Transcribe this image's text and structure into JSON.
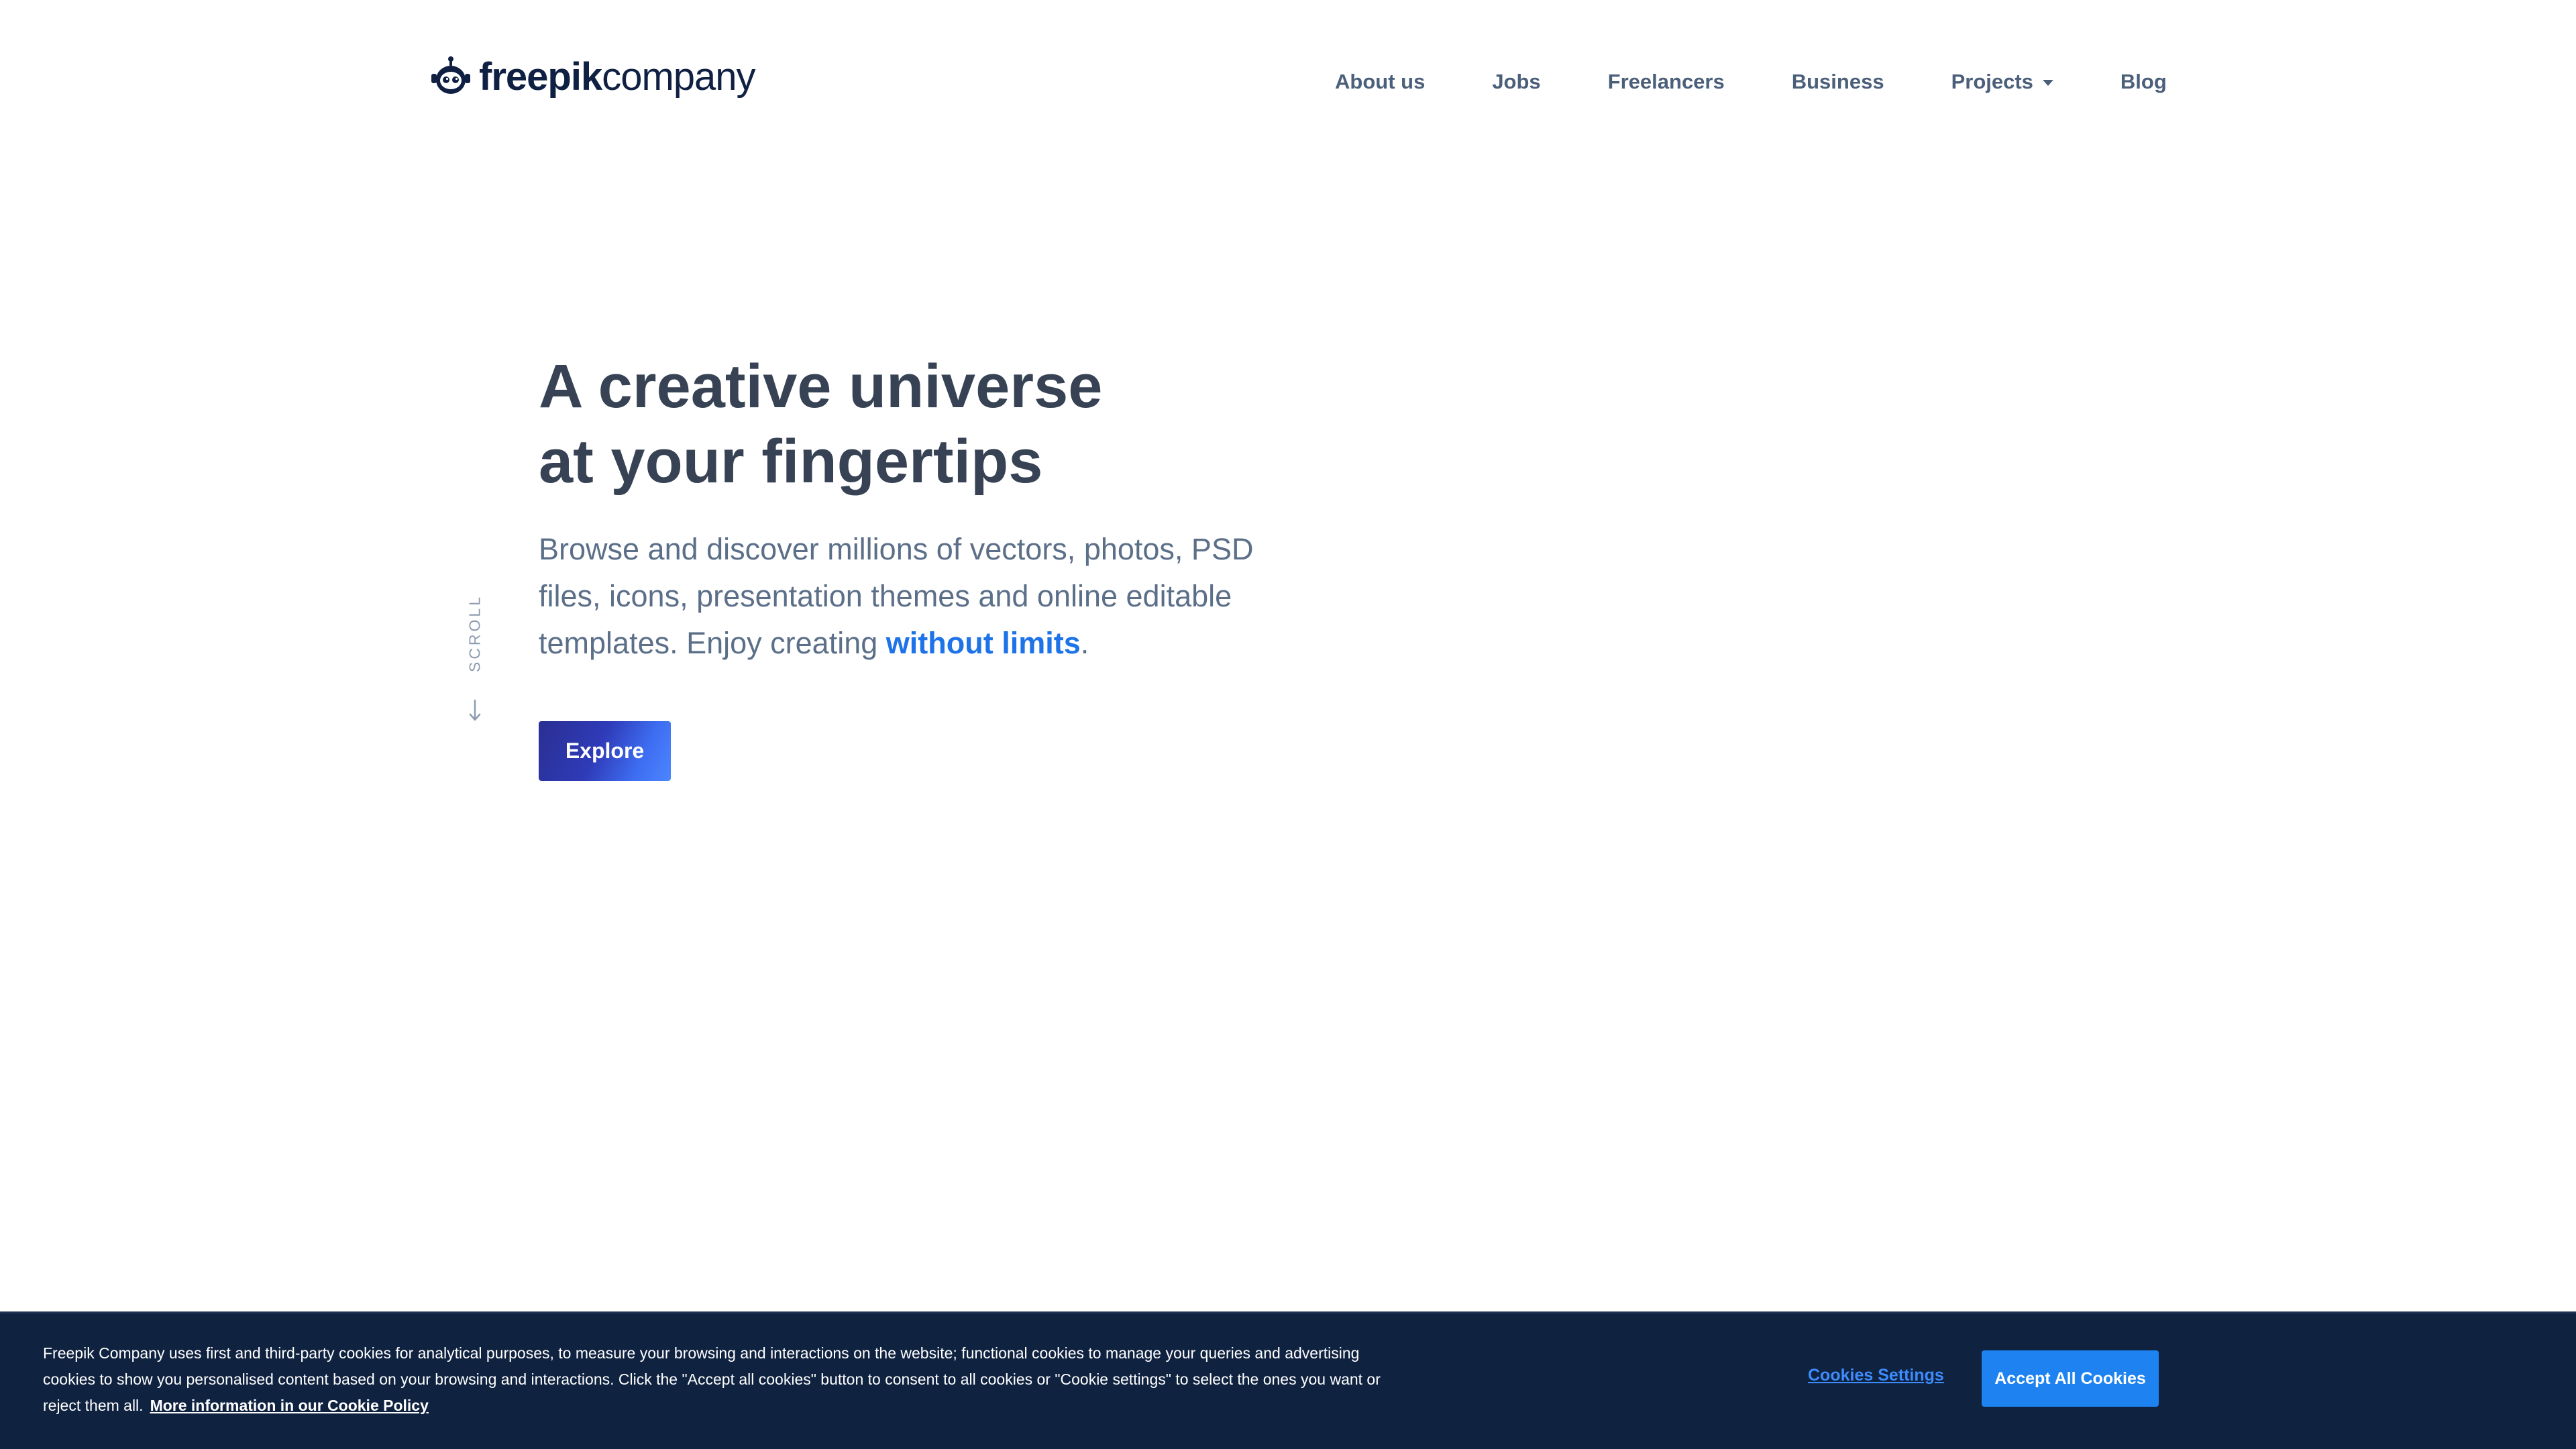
{
  "header": {
    "logo": {
      "icon": "freepik-mascot-icon",
      "text_bold": "freepik",
      "text_regular": "company"
    },
    "nav": [
      {
        "label": "About us"
      },
      {
        "label": "Jobs"
      },
      {
        "label": "Freelancers"
      },
      {
        "label": "Business"
      },
      {
        "label": "Projects",
        "has_dropdown": true
      },
      {
        "label": "Blog"
      }
    ]
  },
  "hero": {
    "title_line1": "A creative universe",
    "title_line2": "at your fingertips",
    "description_before": "Browse and discover millions of vectors, photos, PSD files, icons, presentation themes and online editable templates. Enjoy creating ",
    "description_highlight": "without limits",
    "description_after": ".",
    "cta_label": "Explore",
    "scroll_label": "SCROLL",
    "scroll_icon": "arrow-down-icon"
  },
  "cookie_banner": {
    "text": "Freepik Company uses first and third-party cookies for analytical purposes, to measure your browsing and interactions on the website; functional cookies to manage your queries and advertising cookies to show you personalised content based on your browsing and interactions. Click the \"Accept all cookies\" button to consent to all cookies or \"Cookie settings\" to select the ones you want or reject them all.",
    "policy_link": "More information in our Cookie Policy",
    "settings_label": "Cookies Settings",
    "accept_label": "Accept All Cookies"
  },
  "colors": {
    "heading": "#374354",
    "body_text": "#5b6f88",
    "nav_text": "#4b5f7a",
    "accent": "#1e73e8",
    "banner_bg": "#0f2240",
    "accept_button": "#1e82f0",
    "explore_gradient_start": "#2a2f92",
    "explore_gradient_end": "#4c86ff"
  }
}
